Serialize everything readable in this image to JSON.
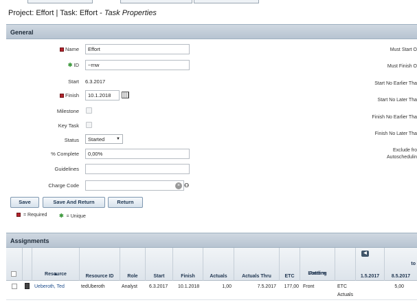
{
  "page_title": {
    "prefix": "Project: Effort | Task: Effort - ",
    "emphasis": "Task Properties"
  },
  "general": {
    "header": "General",
    "name": {
      "label": "Name",
      "value": "Effort"
    },
    "id": {
      "label": "ID",
      "value": "~rnw"
    },
    "start": {
      "label": "Start",
      "value": "6.3.2017"
    },
    "finish": {
      "label": "Finish",
      "value": "10.1.2018"
    },
    "milestone": {
      "label": "Milestone"
    },
    "key_task": {
      "label": "Key Task"
    },
    "status": {
      "label": "Status",
      "value": "Started"
    },
    "percent_complete": {
      "label": "% Complete",
      "value": "0,00%"
    },
    "guidelines": {
      "label": "Guidelines",
      "value": ""
    },
    "charge_code": {
      "label": "Charge Code",
      "value": ""
    }
  },
  "right_labels": {
    "must_start": "Must Start O",
    "must_finish": "Must Finish O",
    "start_no_earlier": "Start No Earlier Tha",
    "start_no_later": "Start No Later Tha",
    "finish_no_earlier": "Finish No Earlier Tha",
    "finish_no_later": "Finish No Later Tha",
    "exclude_line1": "Exclude fro",
    "exclude_line2": "Autoschedulin"
  },
  "buttons": {
    "save": "Save",
    "save_and_return": "Save And Return",
    "return": "Return"
  },
  "legend": {
    "required": "= Required",
    "unique": "= Unique"
  },
  "assignments": {
    "header": "Assignments",
    "columns": {
      "resource": "Resource",
      "resource_id": "Resource ID",
      "role": "Role",
      "start": "Start",
      "finish": "Finish",
      "actuals": "Actuals",
      "actuals_thru": "Actuals Thru",
      "etc": "ETC",
      "loading_line1": "Loading",
      "loading_line2": "Pattern",
      "date1": "1.5.2017",
      "date2": "8.5.2017",
      "top_right": "to"
    },
    "row": {
      "resource": "Ueberoth, Ted",
      "resource_id": "tedUberoth",
      "role": "Analyst",
      "start": "6.3.2017",
      "finish": "10.1.2018",
      "actuals": "1,00",
      "actuals_thru": "7.5.2017",
      "etc": "177,00",
      "loading_pattern": "Front",
      "type_line1": "ETC",
      "type_line2": "Actuals",
      "date2_value": "5,00"
    }
  }
}
